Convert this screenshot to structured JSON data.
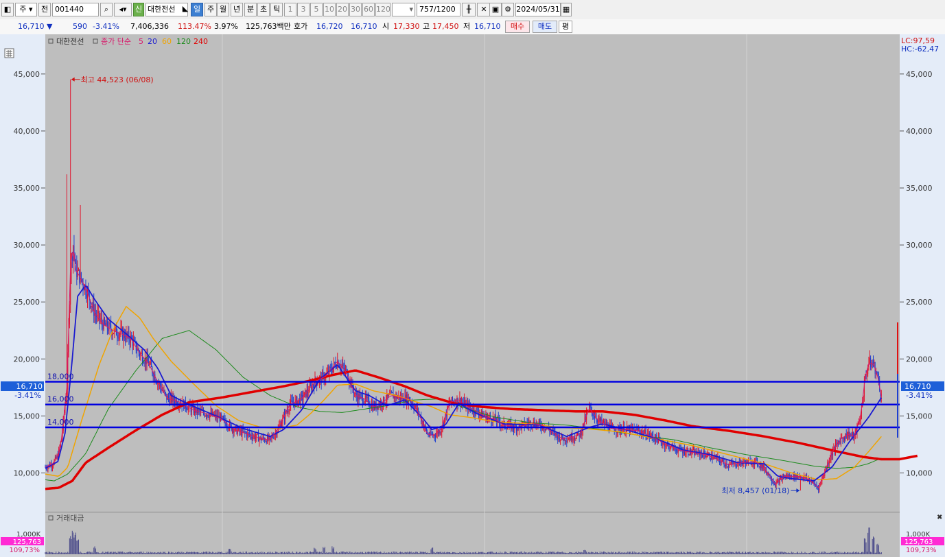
{
  "toolbar": {
    "market": "주",
    "prefix": "전",
    "code": "001440",
    "new_badge": "신",
    "stock_name": "대한전선",
    "periods": [
      "일",
      "주",
      "월",
      "년",
      "분",
      "초",
      "틱"
    ],
    "intervals": [
      "1",
      "3",
      "5",
      "10",
      "20",
      "30",
      "60",
      "120"
    ],
    "count": "757",
    "count_max": "/1200",
    "date": "2024/05/31"
  },
  "quote": {
    "price": "16,710",
    "change": "590",
    "change_pct": "-3.41%",
    "volume": "7,406,336",
    "vol_ratio": "113.47%",
    "turnover": "3.97%",
    "amount": "125,763백만",
    "hoga_label": "호가",
    "ask": "16,720",
    "bid": "16,710",
    "open_label": "시",
    "open": "17,330",
    "high_label": "고",
    "high": "17,450",
    "low_label": "저",
    "low": "16,710",
    "buy_label": "매수",
    "sell_label": "매도",
    "eval_label": "평"
  },
  "panel": {
    "title": "대한전선",
    "ma_label": "종가 단순",
    "ma_periods": [
      "5",
      "20",
      "60",
      "120",
      "240"
    ],
    "lc": "LC:97,59",
    "hc": "HC:-62,47",
    "current_price": "16,710",
    "current_pct": "-3.41%",
    "vol_title": "거래대금",
    "vol_tick": "1,000K",
    "vol_current": "125,763",
    "vol_pct": "109,73%"
  },
  "colors": {
    "up": "#e0142d",
    "down": "#1d3fd0",
    "ma5": "#d8186a",
    "ma20": "#1a1ad0",
    "ma60": "#f0a400",
    "ma120": "#1b8a1b",
    "ma240": "#e00000",
    "hline": "#0000e0",
    "bg": "#bebebe"
  },
  "chart_data": {
    "type": "line",
    "series_type": "candlestick with moving averages",
    "ylim": [
      7800,
      48000
    ],
    "y_ticks": [
      10000,
      15000,
      20000,
      25000,
      30000,
      35000,
      40000,
      45000
    ],
    "y_tick_labels": [
      "10,000",
      "15,000",
      "20,000",
      "25,000",
      "30,000",
      "35,000",
      "40,000",
      "45,000"
    ],
    "price_path": [
      [
        0,
        10500
      ],
      [
        8,
        10800
      ],
      [
        14,
        11500
      ],
      [
        18,
        13000
      ],
      [
        24,
        17500
      ],
      [
        28,
        28000
      ],
      [
        31,
        30000
      ],
      [
        34,
        27800
      ],
      [
        40,
        27000
      ],
      [
        46,
        26000
      ],
      [
        55,
        24000
      ],
      [
        65,
        23000
      ],
      [
        75,
        22500
      ],
      [
        85,
        22200
      ],
      [
        95,
        21800
      ],
      [
        105,
        20500
      ],
      [
        115,
        19600
      ],
      [
        125,
        18000
      ],
      [
        135,
        16600
      ],
      [
        150,
        16200
      ],
      [
        165,
        15500
      ],
      [
        180,
        15200
      ],
      [
        195,
        14800
      ],
      [
        210,
        13800
      ],
      [
        225,
        13400
      ],
      [
        240,
        13000
      ],
      [
        250,
        12900
      ],
      [
        260,
        14000
      ],
      [
        272,
        16000
      ],
      [
        285,
        16500
      ],
      [
        300,
        18000
      ],
      [
        312,
        18500
      ],
      [
        325,
        19800
      ],
      [
        335,
        18800
      ],
      [
        345,
        16800
      ],
      [
        355,
        16500
      ],
      [
        365,
        15800
      ],
      [
        375,
        16200
      ],
      [
        385,
        16800
      ],
      [
        395,
        16600
      ],
      [
        405,
        16500
      ],
      [
        415,
        15300
      ],
      [
        425,
        13400
      ],
      [
        432,
        13300
      ],
      [
        440,
        13800
      ],
      [
        450,
        16200
      ],
      [
        460,
        16400
      ],
      [
        470,
        15800
      ],
      [
        480,
        15400
      ],
      [
        490,
        14900
      ],
      [
        500,
        14700
      ],
      [
        510,
        14200
      ],
      [
        525,
        14000
      ],
      [
        540,
        14400
      ],
      [
        555,
        14100
      ],
      [
        565,
        13500
      ],
      [
        575,
        13000
      ],
      [
        585,
        13100
      ],
      [
        595,
        13400
      ],
      [
        605,
        15700
      ],
      [
        615,
        14600
      ],
      [
        630,
        13900
      ],
      [
        645,
        13800
      ],
      [
        660,
        13700
      ],
      [
        675,
        13200
      ],
      [
        690,
        12500
      ],
      [
        705,
        12000
      ],
      [
        720,
        11800
      ],
      [
        735,
        11600
      ],
      [
        745,
        11300
      ],
      [
        760,
        10700
      ],
      [
        775,
        10900
      ],
      [
        790,
        11000
      ],
      [
        800,
        10400
      ],
      [
        812,
        9000
      ],
      [
        822,
        9700
      ],
      [
        830,
        9700
      ],
      [
        840,
        9700
      ],
      [
        850,
        9400
      ],
      [
        860,
        8700
      ],
      [
        866,
        9900
      ],
      [
        875,
        11800
      ],
      [
        885,
        13000
      ],
      [
        893,
        13400
      ],
      [
        900,
        13200
      ],
      [
        907,
        15000
      ],
      [
        912,
        18400
      ],
      [
        916,
        19600
      ],
      [
        921,
        19600
      ],
      [
        926,
        18400
      ],
      [
        930,
        16710
      ]
    ],
    "ma20_path": [
      [
        0,
        10400
      ],
      [
        14,
        11000
      ],
      [
        22,
        13500
      ],
      [
        30,
        20000
      ],
      [
        36,
        25500
      ],
      [
        45,
        26500
      ],
      [
        55,
        25200
      ],
      [
        70,
        23500
      ],
      [
        90,
        22200
      ],
      [
        110,
        20800
      ],
      [
        125,
        19200
      ],
      [
        140,
        16800
      ],
      [
        160,
        16000
      ],
      [
        190,
        15000
      ],
      [
        220,
        13900
      ],
      [
        250,
        13200
      ],
      [
        265,
        13800
      ],
      [
        285,
        15500
      ],
      [
        305,
        18200
      ],
      [
        325,
        19500
      ],
      [
        345,
        17200
      ],
      [
        360,
        16800
      ],
      [
        380,
        15900
      ],
      [
        400,
        16400
      ],
      [
        420,
        14800
      ],
      [
        430,
        13800
      ],
      [
        445,
        14200
      ],
      [
        460,
        16100
      ],
      [
        480,
        15200
      ],
      [
        510,
        14300
      ],
      [
        550,
        14200
      ],
      [
        580,
        13200
      ],
      [
        605,
        14000
      ],
      [
        620,
        14300
      ],
      [
        650,
        13700
      ],
      [
        680,
        13000
      ],
      [
        710,
        12000
      ],
      [
        740,
        11600
      ],
      [
        770,
        10900
      ],
      [
        800,
        10800
      ],
      [
        815,
        9700
      ],
      [
        830,
        9500
      ],
      [
        855,
        9300
      ],
      [
        875,
        10500
      ],
      [
        895,
        12800
      ],
      [
        915,
        14800
      ],
      [
        930,
        16600
      ]
    ],
    "ma60_path": [
      [
        0,
        9900
      ],
      [
        15,
        9700
      ],
      [
        25,
        10500
      ],
      [
        40,
        14500
      ],
      [
        60,
        19500
      ],
      [
        75,
        22500
      ],
      [
        90,
        24600
      ],
      [
        105,
        23600
      ],
      [
        120,
        21800
      ],
      [
        140,
        19800
      ],
      [
        165,
        17800
      ],
      [
        190,
        15900
      ],
      [
        215,
        14600
      ],
      [
        240,
        14000
      ],
      [
        260,
        13900
      ],
      [
        280,
        14200
      ],
      [
        295,
        15200
      ],
      [
        310,
        16400
      ],
      [
        325,
        17700
      ],
      [
        345,
        17800
      ],
      [
        365,
        17200
      ],
      [
        390,
        16800
      ],
      [
        410,
        16300
      ],
      [
        430,
        15800
      ],
      [
        450,
        15100
      ],
      [
        470,
        14900
      ],
      [
        500,
        14500
      ],
      [
        540,
        14300
      ],
      [
        570,
        14000
      ],
      [
        600,
        13900
      ],
      [
        640,
        13600
      ],
      [
        680,
        13000
      ],
      [
        720,
        12400
      ],
      [
        760,
        11600
      ],
      [
        800,
        10800
      ],
      [
        830,
        10000
      ],
      [
        860,
        9400
      ],
      [
        880,
        9500
      ],
      [
        900,
        10500
      ],
      [
        915,
        11800
      ],
      [
        930,
        13200
      ]
    ],
    "ma120_path": [
      [
        0,
        9400
      ],
      [
        10,
        9300
      ],
      [
        25,
        9900
      ],
      [
        45,
        11700
      ],
      [
        70,
        15600
      ],
      [
        100,
        18900
      ],
      [
        130,
        21800
      ],
      [
        160,
        22500
      ],
      [
        190,
        20800
      ],
      [
        220,
        18400
      ],
      [
        250,
        16800
      ],
      [
        280,
        15800
      ],
      [
        305,
        15400
      ],
      [
        330,
        15300
      ],
      [
        355,
        15600
      ],
      [
        380,
        15900
      ],
      [
        410,
        16400
      ],
      [
        440,
        16500
      ],
      [
        470,
        15600
      ],
      [
        500,
        14900
      ],
      [
        540,
        14400
      ],
      [
        580,
        14200
      ],
      [
        620,
        13800
      ],
      [
        660,
        13300
      ],
      [
        700,
        12900
      ],
      [
        740,
        12200
      ],
      [
        780,
        11600
      ],
      [
        820,
        11100
      ],
      [
        855,
        10600
      ],
      [
        880,
        10400
      ],
      [
        900,
        10500
      ],
      [
        915,
        10800
      ],
      [
        930,
        11300
      ]
    ],
    "ma240_path": [
      [
        0,
        8600
      ],
      [
        15,
        8700
      ],
      [
        30,
        9300
      ],
      [
        45,
        10900
      ],
      [
        70,
        12200
      ],
      [
        100,
        13700
      ],
      [
        130,
        15100
      ],
      [
        160,
        16200
      ],
      [
        195,
        16600
      ],
      [
        230,
        17100
      ],
      [
        265,
        17600
      ],
      [
        295,
        18100
      ],
      [
        320,
        18600
      ],
      [
        345,
        19000
      ],
      [
        370,
        18400
      ],
      [
        400,
        17600
      ],
      [
        425,
        16800
      ],
      [
        455,
        16100
      ],
      [
        485,
        15800
      ],
      [
        520,
        15600
      ],
      [
        555,
        15500
      ],
      [
        590,
        15400
      ],
      [
        620,
        15400
      ],
      [
        655,
        15100
      ],
      [
        690,
        14600
      ],
      [
        720,
        14100
      ],
      [
        760,
        13700
      ],
      [
        800,
        13200
      ],
      [
        840,
        12600
      ],
      [
        880,
        11900
      ],
      [
        910,
        11400
      ],
      [
        930,
        11200
      ],
      [
        950,
        11200
      ],
      [
        970,
        11500
      ]
    ],
    "volume_spikes": [
      [
        28,
        700
      ],
      [
        31,
        1000
      ],
      [
        33,
        800
      ],
      [
        36,
        600
      ],
      [
        55,
        300
      ],
      [
        205,
        250
      ],
      [
        300,
        250
      ],
      [
        310,
        280
      ],
      [
        320,
        300
      ],
      [
        430,
        250
      ],
      [
        600,
        200
      ],
      [
        912,
        600
      ],
      [
        916,
        1000
      ],
      [
        921,
        700
      ],
      [
        926,
        400
      ]
    ],
    "horizontal_lines": [
      18000,
      16000,
      14000
    ],
    "hline_labels": [
      "18,000",
      "16,000",
      "14,000"
    ],
    "annotations": [
      {
        "text": "최고 44,523 (06/08)",
        "value": 44523
      },
      {
        "text": "최저 8,457 (01/18)",
        "value": 8457
      }
    ]
  }
}
